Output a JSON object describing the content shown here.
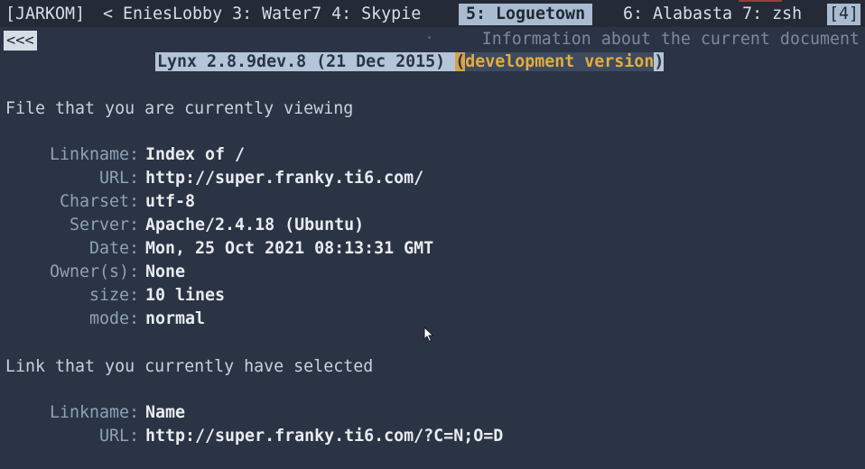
{
  "tabbar": {
    "session": "[JARKOM]",
    "prev_tabs": "< EniesLobby 3: Water7 4: Skypie",
    "active_tab": "5: Loguetown",
    "next_tabs": "6: Alabasta 7: zsh",
    "window_count": "[4]"
  },
  "nav": {
    "back_link": "<<<",
    "page_title": "Information about the current document"
  },
  "version": {
    "main": "Lynx 2.8.9dev.8 (21 Dec 2015) ",
    "cursor": "(",
    "development": "development version",
    "end": ")"
  },
  "document": {
    "heading": "File that you are currently viewing",
    "fields": [
      {
        "label": "Linkname:",
        "value": "Index of /"
      },
      {
        "label": "URL:",
        "value": "http://super.franky.ti6.com/"
      },
      {
        "label": "Charset:",
        "value": "utf-8"
      },
      {
        "label": "Server:",
        "value": "Apache/2.4.18 (Ubuntu)"
      },
      {
        "label": "Date:",
        "value": "Mon, 25 Oct 2021 08:13:31 GMT"
      },
      {
        "label": "Owner(s):",
        "value": "None"
      },
      {
        "label": "size:",
        "value": "10 lines"
      },
      {
        "label": "mode:",
        "value": "normal"
      }
    ]
  },
  "link": {
    "heading": "Link that you currently have selected",
    "fields": [
      {
        "label": "Linkname:",
        "value": "Name"
      },
      {
        "label": "URL:",
        "value": "http://super.franky.ti6.com/?C=N;O=D"
      }
    ]
  },
  "colors": {
    "background": "#2b3444",
    "active_tab": "#a8bbd0",
    "label": "#8ea2b8",
    "dev_version": "#e2ae3e"
  }
}
